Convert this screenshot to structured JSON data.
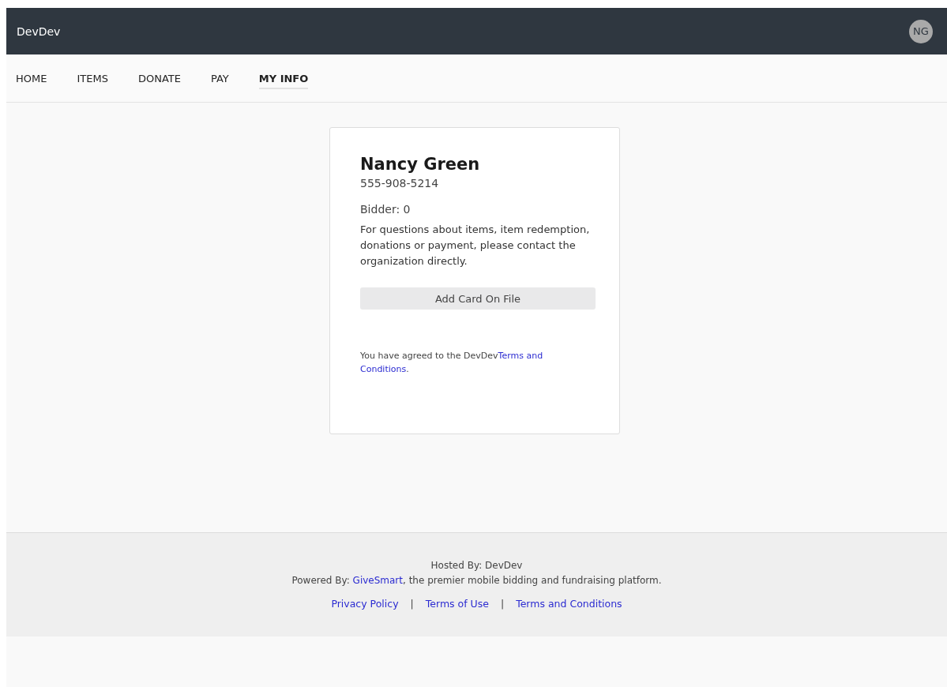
{
  "header": {
    "brand": "DevDev",
    "avatar": "NG"
  },
  "nav": [
    {
      "label": "HOME",
      "selected": false
    },
    {
      "label": "ITEMS",
      "selected": false
    },
    {
      "label": "DONATE",
      "selected": false
    },
    {
      "label": "PAY",
      "selected": false
    },
    {
      "label": "MY INFO",
      "selected": true
    }
  ],
  "profile": {
    "name": "Nancy Green",
    "phone": "555-908-5214",
    "bidder": "Bidder: 0",
    "info": "For questions about items, item redemption, donations or payment, please contact the organization directly.",
    "button": "Add Card On File",
    "agreement": {
      "before": "You have agreed to the DevDev",
      "link_lines": [
        "Terms and",
        "Conditions"
      ],
      "after": "."
    }
  },
  "footer": {
    "hosted": "Hosted By: DevDev",
    "powered_before": "Powered By: ",
    "powered_link": "GiveSmart",
    "powered_after": ", the premier mobile bidding and fundraising platform.",
    "links": [
      "Privacy Policy",
      "Terms of Use",
      "Terms and Conditions"
    ],
    "separator": "|"
  }
}
